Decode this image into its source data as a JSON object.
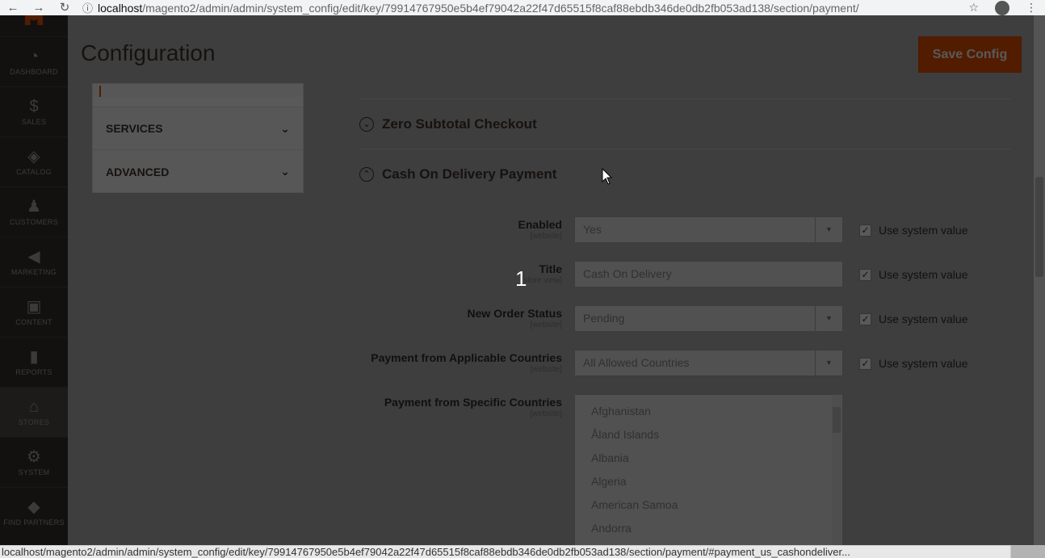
{
  "browser": {
    "back_icon": "arrow-left-icon",
    "forward_icon": "arrow-right-icon",
    "reload_icon": "reload-icon",
    "url_host": "localhost",
    "url_path": "/magento2/admin/admin/system_config/edit/key/79914767950e5b4ef79042a22f47d65515f8caf88ebdb346de0db2fb053ad138/section/payment/",
    "star_icon": "star-icon",
    "menu_icon": "kebab-menu-icon"
  },
  "admin_nav": [
    {
      "label": "DASHBOARD",
      "icon": "dashboard-icon"
    },
    {
      "label": "SALES",
      "icon": "dollar-icon"
    },
    {
      "label": "CATALOG",
      "icon": "cube-icon"
    },
    {
      "label": "CUSTOMERS",
      "icon": "person-icon"
    },
    {
      "label": "MARKETING",
      "icon": "megaphone-icon"
    },
    {
      "label": "CONTENT",
      "icon": "content-icon"
    },
    {
      "label": "REPORTS",
      "icon": "bar-chart-icon"
    },
    {
      "label": "STORES",
      "icon": "store-icon"
    },
    {
      "label": "SYSTEM",
      "icon": "gear-icon"
    },
    {
      "label": "FIND PARTNERS",
      "icon": "partners-icon"
    }
  ],
  "page": {
    "title": "Configuration",
    "save_label": "Save Config"
  },
  "config_tabs": [
    {
      "label": "SERVICES"
    },
    {
      "label": "ADVANCED"
    }
  ],
  "sections": {
    "zero_subtotal": "Zero Subtotal Checkout",
    "cash_on_delivery": "Cash On Delivery Payment"
  },
  "fields": {
    "enabled": {
      "label": "Enabled",
      "scope": "[website]",
      "value": "Yes"
    },
    "title": {
      "label": "Title",
      "scope": "[store view]",
      "value": "Cash On Delivery"
    },
    "new_order_status": {
      "label": "New Order Status",
      "scope": "[website]",
      "value": "Pending"
    },
    "applicable_countries": {
      "label": "Payment from Applicable Countries",
      "scope": "[website]",
      "value": "All Allowed Countries"
    },
    "specific_countries": {
      "label": "Payment from Specific Countries",
      "scope": "[website]",
      "options": [
        "Afghanistan",
        "Åland Islands",
        "Albania",
        "Algeria",
        "American Samoa",
        "Andorra"
      ]
    }
  },
  "use_system_value": "Use system value",
  "step_number": "1",
  "status_url": "localhost/magento2/admin/admin/system_config/edit/key/79914767950e5b4ef79042a22f47d65515f8caf88ebdb346de0db2fb053ad138/section/payment/#payment_us_cashondeliver..."
}
